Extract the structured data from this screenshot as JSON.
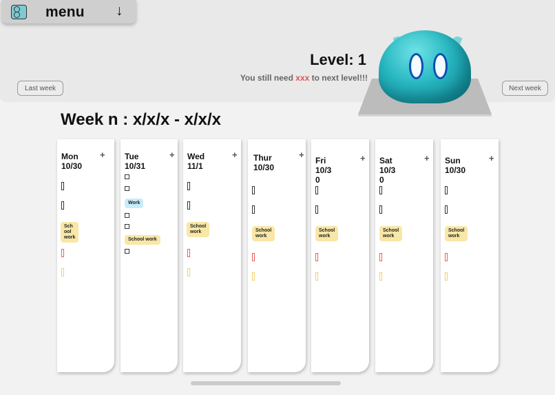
{
  "menu": {
    "label": "menu",
    "arrow": "↓",
    "logo": "genshin-app-logo"
  },
  "nav": {
    "last_week": "Last week",
    "next_week": "Next week"
  },
  "level": {
    "title": "Level: 1",
    "sub_prefix": "You still need ",
    "sub_value": "xxx",
    "sub_suffix": " to next level!!!"
  },
  "week": {
    "title": "Week n : x/x/x - x/x/x"
  },
  "days": [
    {
      "name": "Mon\n10/30",
      "tag": "Sch\nool\nwork"
    },
    {
      "name": "Tue\n10/31",
      "tag_blue": "Work",
      "tag": "School work"
    },
    {
      "name": "Wed\n11/1",
      "tag": "School\nwork"
    },
    {
      "name": "Thur\n10/30",
      "tag": "School\nwork"
    },
    {
      "name": "Fri\n10/3\n0",
      "tag": "School\nwork"
    },
    {
      "name": "Sat\n10/3\n0",
      "tag": "School\nwork"
    },
    {
      "name": "Sun\n10/30",
      "tag": "School\nwork"
    }
  ],
  "colors": {
    "accent_red": "#e05252",
    "tag_yellow": "#f8e7a6",
    "tag_blue": "#c7ecfb"
  }
}
